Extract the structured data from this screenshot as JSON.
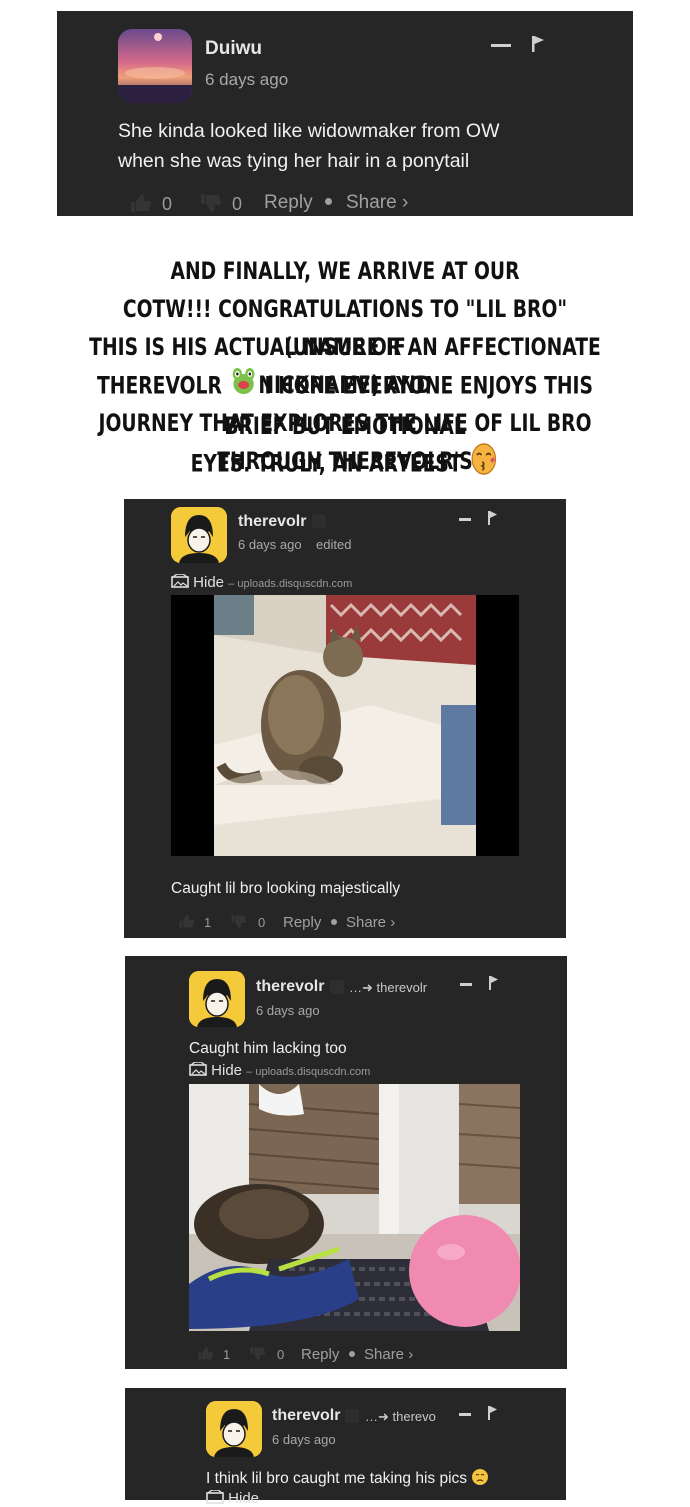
{
  "comments": [
    {
      "username": "Duiwu",
      "time": "6 days ago",
      "text": "She kinda looked like widowmaker from OW when she was tying her hair in a ponytail",
      "upvotes": "0",
      "downvotes": "0",
      "reply": "Reply",
      "share": "Share ›"
    },
    {
      "username": "therevolr",
      "time": "6 days ago",
      "edited": "edited",
      "hide": "Hide",
      "source": "– uploads.disquscdn.com",
      "text": "Caught lil bro looking majestically",
      "upvotes": "1",
      "downvotes": "0",
      "reply": "Reply",
      "share": "Share ›"
    },
    {
      "username": "therevolr",
      "reply_to": "therevolr",
      "time": "6 days ago",
      "text": "Caught him lacking too",
      "hide": "Hide",
      "source": "– uploads.disquscdn.com",
      "upvotes": "1",
      "downvotes": "0",
      "reply": "Reply",
      "share": "Share ›"
    },
    {
      "username": "therevolr",
      "reply_to": "therevo",
      "time": "6 days ago",
      "text": "I think lil bro caught me taking his pics",
      "hide": "Hide"
    }
  ],
  "note": {
    "line1": "AND FINALLY, WE ARRIVE AT OUR",
    "line2": "COTW!!! CONGRATULATIONS TO \"LIL BRO\" (UNSURE IF",
    "line3": "THIS IS HIS ACTUAL NAME OR AN AFFECTIONATE NICKNAME) AND",
    "line4a": "THEREVOLR",
    "line4b": "I HOPE EVERYONE ENJOYS THIS BRIEF BUT EMOTIONAL",
    "line5": "JOURNEY THAT EXPLORES THE LIFE OF LIL BRO THROUGH THEREVOLR'S",
    "line6": "EYES. TRULY, AN ARTEEST"
  },
  "icons": {
    "minimize": "minimize-icon",
    "flag": "flag-icon",
    "reply_arrow": "reply-arrow-icon",
    "image": "image-icon"
  },
  "colors": {
    "card_bg": "#262626",
    "avatar_yellow": "#f4c93a",
    "text": "#f0f0f0",
    "muted": "#a0a0a0"
  }
}
